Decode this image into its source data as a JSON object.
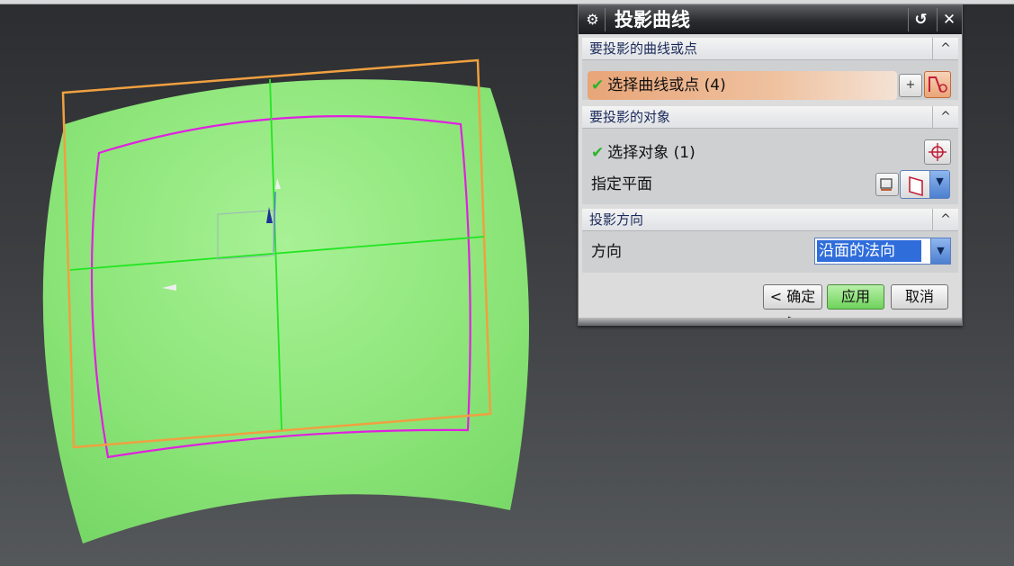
{
  "dialog": {
    "title": "投影曲线",
    "gear_icon": "gear-icon",
    "reset_glyph": "↺",
    "close_glyph": "✕",
    "groups": [
      {
        "header": "要投影的曲线或点",
        "chevron": "^",
        "rows": [
          {
            "check": "✔",
            "label": "选择曲线或点 (4)",
            "icons": [
              "add-curve-icon",
              "curve-select-icon"
            ]
          }
        ]
      },
      {
        "header": "要投影的对象",
        "chevron": "^",
        "rows": [
          {
            "check": "✔",
            "label": "选择对象 (1)",
            "icons": [
              "crosshair-select-icon"
            ]
          },
          {
            "label": "指定平面",
            "icons": [
              "plane-dialog-icon",
              "plane-icon"
            ]
          }
        ]
      },
      {
        "header": "投影方向",
        "chevron": "^",
        "rows": [
          {
            "label": "方向",
            "dropdown_value": "沿面的法向"
          }
        ]
      }
    ],
    "buttons": {
      "ok": "< 确定 >",
      "apply": "应用",
      "cancel": "取消"
    }
  },
  "colors": {
    "surface": "#8ee67a",
    "projection_frame": "#f0a040",
    "projected_curve": "#e020e0",
    "axes": "#22e622",
    "selected_row": "#e8a578",
    "apply_button": "#6fd35b"
  }
}
